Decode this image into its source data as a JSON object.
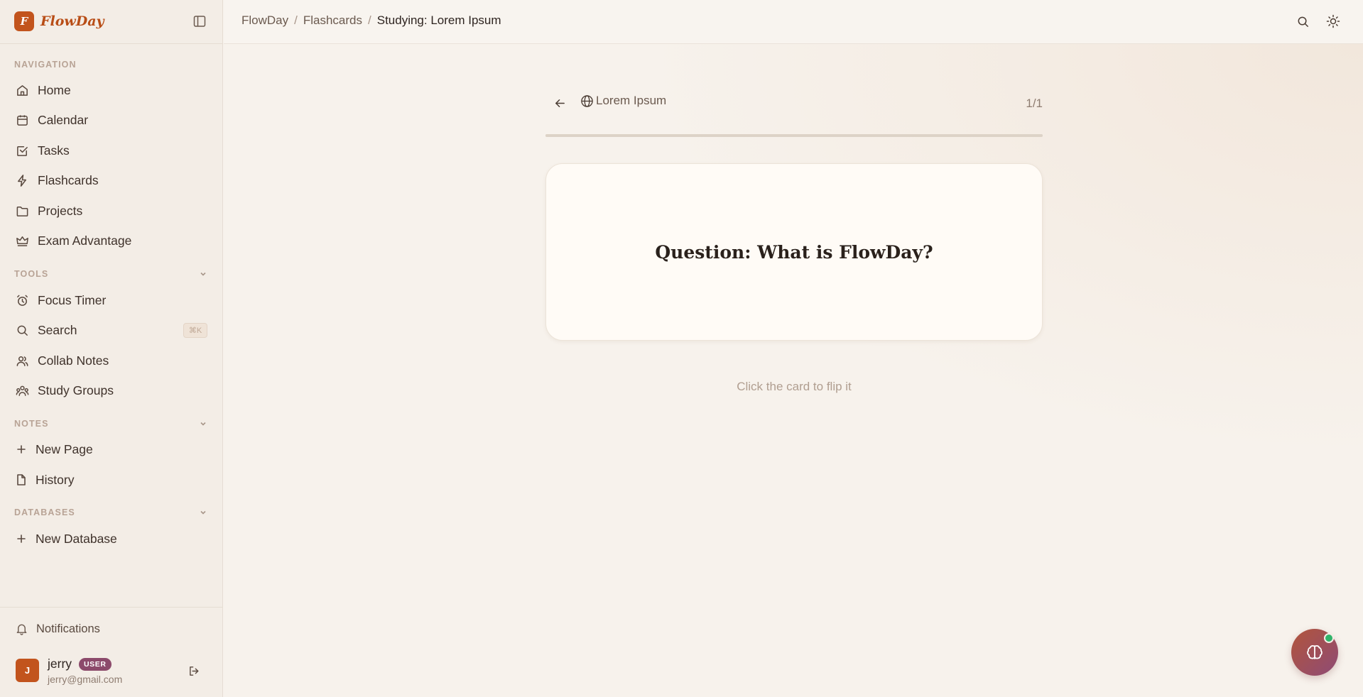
{
  "brand": {
    "logo_letter": "F",
    "name": "FlowDay"
  },
  "sidebar": {
    "sections": {
      "navigation": "NAVIGATION",
      "tools": "TOOLS",
      "notes": "NOTES",
      "databases": "DATABASES"
    },
    "nav_items": [
      {
        "label": "Home",
        "icon": "home-icon"
      },
      {
        "label": "Calendar",
        "icon": "calendar-icon"
      },
      {
        "label": "Tasks",
        "icon": "checkbox-icon"
      },
      {
        "label": "Flashcards",
        "icon": "lightning-icon"
      },
      {
        "label": "Projects",
        "icon": "folder-icon"
      },
      {
        "label": "Exam Advantage",
        "icon": "crown-icon"
      }
    ],
    "tool_items": [
      {
        "label": "Focus Timer",
        "icon": "alarm-clock-icon"
      },
      {
        "label": "Search",
        "icon": "search-icon",
        "shortcut": "⌘K"
      },
      {
        "label": "Collab Notes",
        "icon": "users-icon"
      },
      {
        "label": "Study Groups",
        "icon": "group-icon"
      }
    ],
    "note_items": [
      {
        "label": "New Page",
        "icon": "plus-icon"
      },
      {
        "label": "History",
        "icon": "document-icon"
      }
    ],
    "database_items": [
      {
        "label": "New Database",
        "icon": "plus-icon"
      }
    ],
    "notifications": "Notifications",
    "user": {
      "initial": "J",
      "name": "jerry",
      "role": "USER",
      "email": "jerry@gmail.com"
    }
  },
  "topbar": {
    "breadcrumb": [
      "FlowDay",
      "Flashcards",
      "Studying: Lorem Ipsum"
    ]
  },
  "study": {
    "deck_title": "Lorem Ipsum",
    "counter": "1/1",
    "progress_fraction": 1.0,
    "card_text": "Question: What is FlowDay?",
    "hint": "Click the card to flip it"
  },
  "colors": {
    "brand": "#c2541d",
    "badge": "#8c4a6b",
    "status_online": "#30b36a"
  }
}
